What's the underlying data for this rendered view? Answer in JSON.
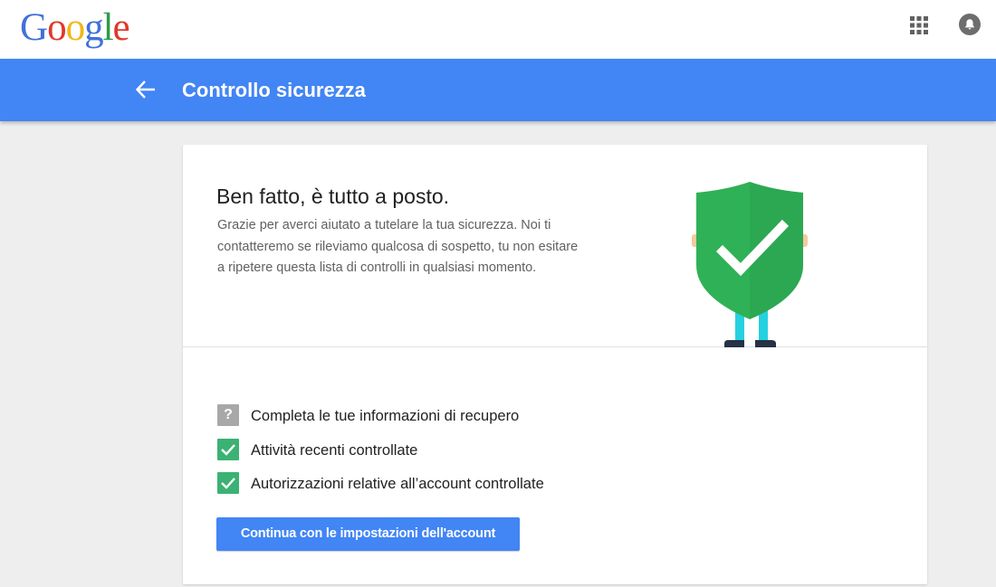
{
  "brand": {
    "letters": [
      {
        "char": "G",
        "color": "#3f71d9"
      },
      {
        "char": "o",
        "color": "#e1382b"
      },
      {
        "char": "o",
        "color": "#f2b619"
      },
      {
        "char": "g",
        "color": "#3f71d9"
      },
      {
        "char": "l",
        "color": "#2d9b4a"
      },
      {
        "char": "e",
        "color": "#e1382b"
      }
    ]
  },
  "topbar": {
    "apps_icon": "apps-grid-icon",
    "notifications_icon": "notifications-bell-icon"
  },
  "header": {
    "back_icon": "arrow-back-icon",
    "title": "Controllo sicurezza",
    "color": "#4285f4"
  },
  "card": {
    "title": "Ben fatto, è tutto a posto.",
    "description": "Grazie per averci aiutato a tutelare la tua sicurezza. Noi ti contatteremo se rileviamo qualcosa di sospetto, tu non esitare a ripetere questa lista di controlli in qualsiasi momento.",
    "illustration": "shield-checkmark-figure",
    "checklist": [
      {
        "status": "unknown",
        "icon": "question-mark-icon",
        "label": "Completa le tue informazioni di recupero"
      },
      {
        "status": "done",
        "icon": "checkmark-icon",
        "label": "Attività recenti controllate"
      },
      {
        "status": "done",
        "icon": "checkmark-icon",
        "label": "Autorizzazioni relative all’account controllate"
      }
    ],
    "continue_label": "Continua con le impostazioni dell'account"
  },
  "colors": {
    "done": "#3bb273",
    "unknown": "#a8a8a8",
    "shield": "#2fb157",
    "button": "#4285f4"
  }
}
